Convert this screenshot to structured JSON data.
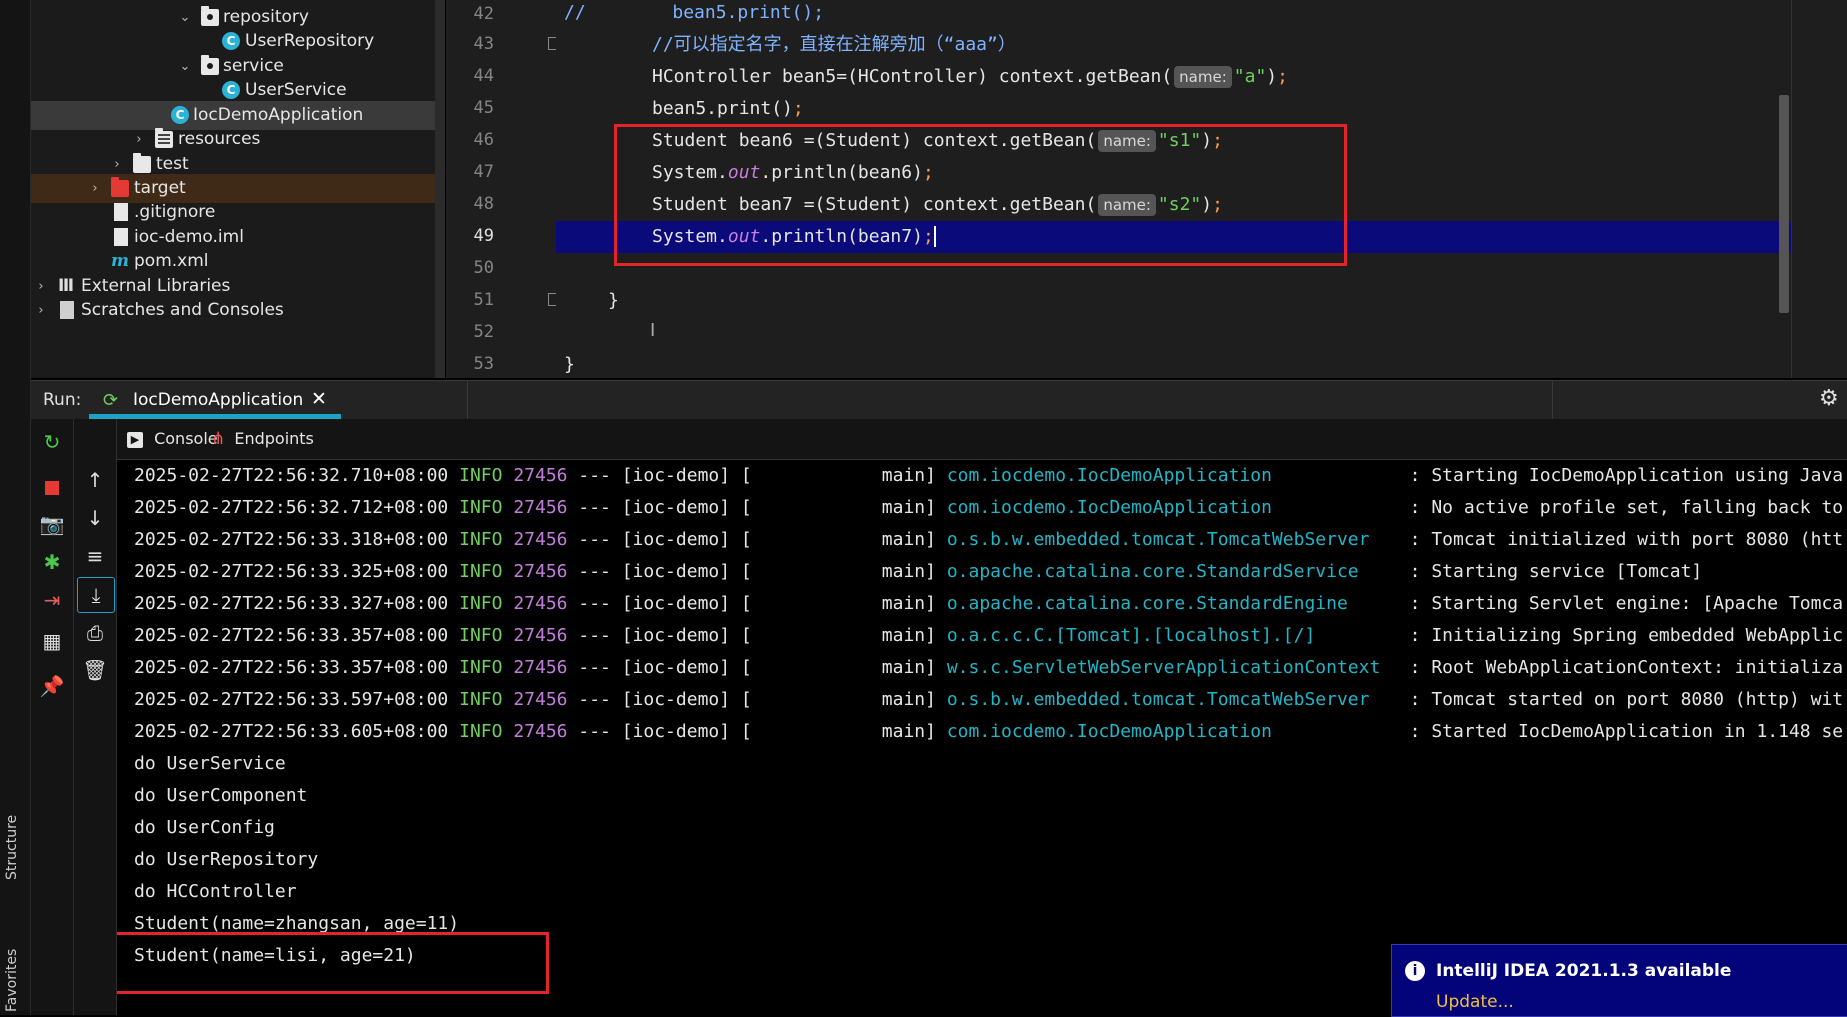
{
  "side_tabs": {
    "structure": "Structure",
    "favorites": "Favorites"
  },
  "tree": {
    "items": [
      {
        "label": "repository",
        "type": "folder"
      },
      {
        "label": "UserRepository",
        "type": "class"
      },
      {
        "label": "service",
        "type": "folder"
      },
      {
        "label": "UserService",
        "type": "class"
      },
      {
        "label": "IocDemoApplication",
        "type": "spring-class"
      },
      {
        "label": "resources",
        "type": "resources-folder"
      },
      {
        "label": "test",
        "type": "folder"
      },
      {
        "label": "target",
        "type": "excluded-folder"
      },
      {
        "label": ".gitignore",
        "type": "file"
      },
      {
        "label": "ioc-demo.iml",
        "type": "file"
      },
      {
        "label": "pom.xml",
        "type": "maven"
      },
      {
        "label": "External Libraries",
        "type": "libraries"
      },
      {
        "label": "Scratches and Consoles",
        "type": "scratches"
      }
    ]
  },
  "editor": {
    "line_numbers": [
      "42",
      "43",
      "44",
      "45",
      "46",
      "47",
      "48",
      "49",
      "50",
      "51",
      "52",
      "53"
    ],
    "current_line": "49",
    "lines": {
      "l42": {
        "comment": "//",
        "code": "        bean5.print();"
      },
      "l43": {
        "comment": "//可以指定名字，直接在注解旁加（“aaa”）"
      },
      "l44": {
        "pre": "HController bean5=(HController) context.getBean(",
        "hint": "name:",
        "str": "\"a\"",
        "post": ")",
        "semi": ";"
      },
      "l45": {
        "pre": "bean5.print()",
        "semi": ";"
      },
      "l46": {
        "pre": "Student bean6 =(Student) context.getBean(",
        "hint": "name:",
        "str": "\"s1\"",
        "post": ")",
        "semi": ";"
      },
      "l47": {
        "pre": "System.",
        "out": "out",
        "post": ".println(bean6)",
        "semi": ";"
      },
      "l48": {
        "pre": "Student bean7 =(Student) context.getBean(",
        "hint": "name:",
        "str": "\"s2\"",
        "post": ")",
        "semi": ";"
      },
      "l49": {
        "pre": "System.",
        "out": "out",
        "post": ".println(bean7)",
        "semi": ";"
      },
      "l51": {
        "code": "}"
      },
      "l53": {
        "code": "}"
      }
    }
  },
  "run_panel": {
    "label": "Run:",
    "tab_label": "IocDemoApplication",
    "close_glyph": "✕",
    "settings_icon": "gear-icon"
  },
  "console_tabs": [
    {
      "label": "Console",
      "icon": "console-icon"
    },
    {
      "label": "Endpoints",
      "icon": "endpoints-icon"
    }
  ],
  "console": {
    "log_lines": [
      {
        "ts": "2025-02-27T22:56:32.710+08:00",
        "level": "INFO",
        "pid": "27456",
        "sep": "--- [ioc-demo] [",
        "thread": "main]",
        "logger": "com.iocdemo.IocDemoApplication",
        "msg": ": Starting IocDemoApplication using Java"
      },
      {
        "ts": "2025-02-27T22:56:32.712+08:00",
        "level": "INFO",
        "pid": "27456",
        "sep": "--- [ioc-demo] [",
        "thread": "main]",
        "logger": "com.iocdemo.IocDemoApplication",
        "msg": ": No active profile set, falling back to"
      },
      {
        "ts": "2025-02-27T22:56:33.318+08:00",
        "level": "INFO",
        "pid": "27456",
        "sep": "--- [ioc-demo] [",
        "thread": "main]",
        "logger": "o.s.b.w.embedded.tomcat.TomcatWebServer",
        "msg": ": Tomcat initialized with port 8080 (htt"
      },
      {
        "ts": "2025-02-27T22:56:33.325+08:00",
        "level": "INFO",
        "pid": "27456",
        "sep": "--- [ioc-demo] [",
        "thread": "main]",
        "logger": "o.apache.catalina.core.StandardService",
        "msg": ": Starting service [Tomcat]"
      },
      {
        "ts": "2025-02-27T22:56:33.327+08:00",
        "level": "INFO",
        "pid": "27456",
        "sep": "--- [ioc-demo] [",
        "thread": "main]",
        "logger": "o.apache.catalina.core.StandardEngine",
        "msg": ": Starting Servlet engine: [Apache Tomca"
      },
      {
        "ts": "2025-02-27T22:56:33.357+08:00",
        "level": "INFO",
        "pid": "27456",
        "sep": "--- [ioc-demo] [",
        "thread": "main]",
        "logger": "o.a.c.c.C.[Tomcat].[localhost].[/]",
        "msg": ": Initializing Spring embedded WebApplic"
      },
      {
        "ts": "2025-02-27T22:56:33.357+08:00",
        "level": "INFO",
        "pid": "27456",
        "sep": "--- [ioc-demo] [",
        "thread": "main]",
        "logger": "w.s.c.ServletWebServerApplicationContext",
        "msg": ": Root WebApplicationContext: initializa"
      },
      {
        "ts": "2025-02-27T22:56:33.597+08:00",
        "level": "INFO",
        "pid": "27456",
        "sep": "--- [ioc-demo] [",
        "thread": "main]",
        "logger": "o.s.b.w.embedded.tomcat.TomcatWebServer",
        "msg": ": Tomcat started on port 8080 (http) wit"
      },
      {
        "ts": "2025-02-27T22:56:33.605+08:00",
        "level": "INFO",
        "pid": "27456",
        "sep": "--- [ioc-demo] [",
        "thread": "main]",
        "logger": "com.iocdemo.IocDemoApplication",
        "msg": ": Started IocDemoApplication in 1.148 se"
      }
    ],
    "output_lines": [
      "do UserService",
      "do UserComponent",
      "do UserConfig",
      "do UserRepository",
      "do HCController",
      "Student(name=zhangsan, age=11)",
      "Student(name=lisi, age=21)"
    ]
  },
  "notification": {
    "title": "IntelliJ IDEA 2021.1.3 available",
    "link": "Update..."
  },
  "colors": {
    "highlight_box": "#e3242b",
    "current_line": "#0a0a7a",
    "info": "#6fcf5f",
    "logger": "#22b5c8",
    "pid": "#c77dde",
    "accent_tab": "#1fa2c8"
  }
}
